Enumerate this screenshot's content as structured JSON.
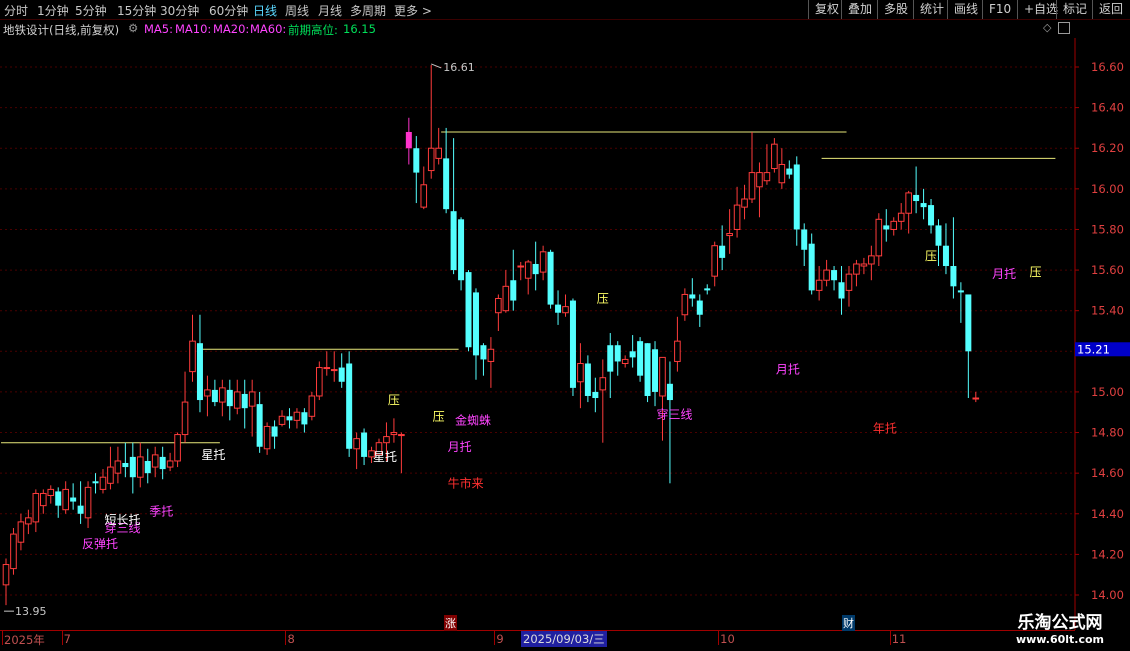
{
  "toolbar": {
    "periods": [
      "分时",
      "1分钟",
      "5分钟",
      "15分钟",
      "30分钟",
      "60分钟",
      "日线",
      "周线",
      "月线",
      "多周期",
      "更多 >"
    ],
    "active": "日线",
    "right_buttons": [
      "复权",
      "叠加",
      "多股",
      "统计",
      "画线",
      "F10",
      "+自选",
      "标记",
      "返回"
    ]
  },
  "infobar": {
    "title": "地铁设计(日线,前复权)",
    "ma5": "MA5:",
    "ma10": "MA10:",
    "ma20": "MA20:",
    "ma60": "MA60:",
    "prev_high_label": "前期高位:",
    "prev_high_value": "16.15"
  },
  "colors": {
    "up": "#ff3c3c",
    "down": "#54ffff",
    "resist_line": "#e8e87a",
    "label_magenta": "#ff44ff",
    "label_red": "#ff3030",
    "label_white": "#ffffff",
    "label_yellow": "#ffff66",
    "axis": "#a00000"
  },
  "chart_data": {
    "type": "candlestick",
    "y_axis_ticks": [
      "16.60",
      "16.40",
      "16.20",
      "16.00",
      "15.80",
      "15.60",
      "15.40",
      "15.20",
      "15.00",
      "14.80",
      "14.60",
      "14.40",
      "14.20",
      "14.00"
    ],
    "ylim": [
      14.0,
      16.6
    ],
    "current_price": "15.21",
    "high_label": "16.61",
    "low_label": "13.95",
    "candles": [
      [
        14.05,
        14.15,
        13.95,
        14.18
      ],
      [
        14.13,
        14.3,
        14.1,
        14.33
      ],
      [
        14.26,
        14.36,
        14.22,
        14.4
      ],
      [
        14.35,
        14.38,
        14.3,
        14.42
      ],
      [
        14.36,
        14.5,
        14.31,
        14.52
      ],
      [
        14.44,
        14.5,
        14.4,
        14.52
      ],
      [
        14.49,
        14.52,
        14.45,
        14.54
      ],
      [
        14.51,
        14.44,
        14.38,
        14.53
      ],
      [
        14.42,
        14.52,
        14.4,
        14.56
      ],
      [
        14.48,
        14.46,
        14.42,
        14.55
      ],
      [
        14.44,
        14.4,
        14.35,
        14.56
      ],
      [
        14.38,
        14.53,
        14.33,
        14.56
      ],
      [
        14.56,
        14.55,
        14.5,
        14.6
      ],
      [
        14.52,
        14.58,
        14.5,
        14.62
      ],
      [
        14.55,
        14.63,
        14.52,
        14.73
      ],
      [
        14.6,
        14.66,
        14.55,
        14.73
      ],
      [
        14.65,
        14.63,
        14.58,
        14.75
      ],
      [
        14.68,
        14.58,
        14.5,
        14.75
      ],
      [
        14.58,
        14.68,
        14.53,
        14.75
      ],
      [
        14.66,
        14.6,
        14.55,
        14.72
      ],
      [
        14.63,
        14.69,
        14.58,
        14.73
      ],
      [
        14.68,
        14.62,
        14.57,
        14.73
      ],
      [
        14.63,
        14.66,
        14.61,
        14.7
      ],
      [
        14.66,
        14.79,
        14.63,
        14.8
      ],
      [
        14.79,
        14.95,
        14.75,
        15.1
      ],
      [
        15.1,
        15.25,
        15.05,
        15.38
      ],
      [
        15.24,
        14.96,
        14.9,
        15.38
      ],
      [
        14.98,
        15.01,
        14.88,
        15.08
      ],
      [
        15.01,
        14.95,
        14.93,
        15.06
      ],
      [
        14.95,
        15.02,
        14.88,
        15.06
      ],
      [
        15.01,
        14.93,
        14.86,
        15.06
      ],
      [
        14.92,
        15.0,
        14.89,
        15.06
      ],
      [
        14.99,
        14.92,
        14.82,
        15.06
      ],
      [
        14.93,
        15.0,
        14.78,
        15.06
      ],
      [
        14.94,
        14.73,
        14.7,
        15.0
      ],
      [
        14.72,
        14.83,
        14.69,
        14.85
      ],
      [
        14.83,
        14.78,
        14.72,
        14.86
      ],
      [
        14.84,
        14.88,
        14.83,
        14.91
      ],
      [
        14.88,
        14.86,
        14.82,
        14.92
      ],
      [
        14.86,
        14.9,
        14.82,
        14.92
      ],
      [
        14.9,
        14.84,
        14.8,
        14.92
      ],
      [
        14.88,
        14.98,
        14.86,
        15.0
      ],
      [
        14.98,
        15.12,
        14.96,
        15.15
      ],
      [
        15.12,
        15.12,
        15.08,
        15.2
      ],
      [
        15.11,
        15.11,
        15.05,
        15.2
      ],
      [
        15.12,
        15.05,
        15.02,
        15.19
      ],
      [
        15.14,
        14.72,
        14.68,
        15.2
      ],
      [
        14.72,
        14.77,
        14.62,
        14.8
      ],
      [
        14.8,
        14.68,
        14.64,
        14.82
      ],
      [
        14.68,
        14.71,
        14.65,
        14.73
      ],
      [
        14.69,
        14.75,
        14.67,
        14.77
      ],
      [
        14.75,
        14.78,
        14.66,
        14.85
      ],
      [
        14.79,
        14.8,
        14.75,
        14.87
      ],
      [
        14.79,
        14.79,
        14.6,
        14.8
      ],
      [
        16.28,
        16.2,
        16.12,
        16.35
      ],
      [
        16.2,
        16.08,
        15.93,
        16.26
      ],
      [
        15.91,
        16.02,
        15.9,
        16.11
      ],
      [
        16.09,
        16.2,
        16.05,
        16.61
      ],
      [
        16.15,
        16.2,
        16.12,
        16.3
      ],
      [
        16.15,
        15.9,
        15.88,
        16.3
      ],
      [
        15.89,
        15.6,
        15.58,
        16.25
      ],
      [
        15.85,
        15.55,
        15.5,
        15.86
      ],
      [
        15.59,
        15.22,
        15.2,
        15.6
      ],
      [
        15.49,
        15.18,
        15.06,
        15.51
      ],
      [
        15.23,
        15.16,
        15.08,
        15.24
      ],
      [
        15.15,
        15.21,
        15.02,
        15.27
      ],
      [
        15.39,
        15.46,
        15.3,
        15.48
      ],
      [
        15.4,
        15.52,
        15.39,
        15.6
      ],
      [
        15.55,
        15.45,
        15.4,
        15.7
      ],
      [
        15.62,
        15.62,
        15.55,
        15.64
      ],
      [
        15.56,
        15.64,
        15.48,
        15.65
      ],
      [
        15.63,
        15.58,
        15.5,
        15.74
      ],
      [
        15.59,
        15.69,
        15.55,
        15.72
      ],
      [
        15.69,
        15.43,
        15.41,
        15.7
      ],
      [
        15.43,
        15.39,
        15.33,
        15.5
      ],
      [
        15.39,
        15.42,
        15.37,
        15.48
      ],
      [
        15.45,
        15.02,
        14.98,
        15.46
      ],
      [
        15.05,
        15.14,
        14.92,
        15.24
      ],
      [
        15.14,
        14.98,
        14.95,
        15.18
      ],
      [
        15.0,
        14.97,
        14.9,
        15.07
      ],
      [
        15.01,
        15.07,
        14.75,
        15.16
      ],
      [
        15.23,
        15.1,
        14.97,
        15.29
      ],
      [
        15.23,
        15.15,
        15.08,
        15.25
      ],
      [
        15.14,
        15.16,
        15.12,
        15.18
      ],
      [
        15.2,
        15.17,
        15.12,
        15.28
      ],
      [
        15.25,
        15.08,
        15.05,
        15.27
      ],
      [
        15.24,
        14.98,
        14.95,
        15.24
      ],
      [
        15.21,
        15.0,
        14.93,
        15.25
      ],
      [
        14.98,
        15.17,
        14.76,
        15.17
      ],
      [
        15.04,
        14.96,
        14.55,
        15.15
      ],
      [
        15.15,
        15.25,
        15.1,
        15.37
      ],
      [
        15.38,
        15.48,
        15.35,
        15.51
      ],
      [
        15.48,
        15.46,
        15.42,
        15.56
      ],
      [
        15.45,
        15.38,
        15.32,
        15.48
      ],
      [
        15.51,
        15.5,
        15.48,
        15.53
      ],
      [
        15.57,
        15.72,
        15.52,
        15.74
      ],
      [
        15.72,
        15.66,
        15.6,
        15.82
      ],
      [
        15.77,
        15.78,
        15.68,
        15.9
      ],
      [
        15.8,
        15.92,
        15.76,
        16.01
      ],
      [
        15.91,
        15.95,
        15.85,
        16.02
      ],
      [
        15.95,
        16.08,
        15.93,
        16.28
      ],
      [
        16.01,
        16.08,
        15.86,
        16.13
      ],
      [
        16.04,
        16.08,
        16.02,
        16.22
      ],
      [
        16.1,
        16.22,
        16.08,
        16.25
      ],
      [
        16.03,
        16.12,
        16.0,
        16.2
      ],
      [
        16.1,
        16.07,
        16.05,
        16.14
      ],
      [
        16.12,
        15.8,
        15.72,
        16.16
      ],
      [
        15.8,
        15.7,
        15.62,
        15.83
      ],
      [
        15.73,
        15.5,
        15.48,
        15.78
      ],
      [
        15.5,
        15.55,
        15.45,
        15.62
      ],
      [
        15.55,
        15.6,
        15.52,
        15.65
      ],
      [
        15.6,
        15.55,
        15.5,
        15.62
      ],
      [
        15.54,
        15.46,
        15.38,
        15.62
      ],
      [
        15.5,
        15.58,
        15.42,
        15.62
      ],
      [
        15.58,
        15.63,
        15.52,
        15.65
      ],
      [
        15.62,
        15.63,
        15.58,
        15.66
      ],
      [
        15.63,
        15.67,
        15.55,
        15.72
      ],
      [
        15.67,
        15.85,
        15.62,
        15.88
      ],
      [
        15.82,
        15.8,
        15.74,
        15.9
      ],
      [
        15.8,
        15.84,
        15.77,
        15.86
      ],
      [
        15.84,
        15.88,
        15.8,
        15.93
      ],
      [
        15.88,
        15.98,
        15.78,
        15.99
      ],
      [
        15.97,
        15.94,
        15.88,
        16.11
      ],
      [
        15.93,
        15.91,
        15.85,
        16.0
      ],
      [
        15.92,
        15.82,
        15.78,
        15.95
      ],
      [
        15.82,
        15.72,
        15.62,
        15.85
      ],
      [
        15.72,
        15.62,
        15.58,
        15.83
      ],
      [
        15.62,
        15.52,
        15.46,
        15.86
      ],
      [
        15.5,
        15.49,
        15.34,
        15.54
      ],
      [
        15.48,
        15.2,
        14.97,
        15.33
      ],
      [
        14.97,
        14.97,
        14.95,
        15.0
      ]
    ],
    "signal_labels": [
      {
        "text": "反弹托",
        "x_index": 11,
        "price": 14.25,
        "color": "magenta"
      },
      {
        "text": "穿三线",
        "x_index": 14,
        "price": 14.33,
        "color": "magenta"
      },
      {
        "text": "短长托",
        "x_index": 14,
        "price": 14.37,
        "color": "white"
      },
      {
        "text": "季托",
        "x_index": 20,
        "price": 14.41,
        "color": "magenta"
      },
      {
        "text": "星托",
        "x_index": 27,
        "price": 14.69,
        "color": "white"
      },
      {
        "text": "星托",
        "x_index": 50,
        "price": 14.68,
        "color": "white"
      },
      {
        "text": "压",
        "x_index": 52,
        "price": 14.96,
        "color": "yellow"
      },
      {
        "text": "压",
        "x_index": 58,
        "price": 14.88,
        "color": "yellow"
      },
      {
        "text": "金蜘蛛",
        "x_index": 61,
        "price": 14.86,
        "color": "magenta"
      },
      {
        "text": "月托",
        "x_index": 60,
        "price": 14.73,
        "color": "magenta"
      },
      {
        "text": "牛市来",
        "x_index": 60,
        "price": 14.55,
        "color": "red"
      },
      {
        "text": "压",
        "x_index": 80,
        "price": 15.46,
        "color": "yellow"
      },
      {
        "text": "穿三线",
        "x_index": 88,
        "price": 14.89,
        "color": "magenta"
      },
      {
        "text": "月托",
        "x_index": 104,
        "price": 15.11,
        "color": "magenta"
      },
      {
        "text": "年托",
        "x_index": 117,
        "price": 14.82,
        "color": "red"
      },
      {
        "text": "压",
        "x_index": 124,
        "price": 15.67,
        "color": "yellow"
      },
      {
        "text": "月托",
        "x_index": 133,
        "price": 15.58,
        "color": "magenta"
      },
      {
        "text": "压",
        "x_index": 138,
        "price": 15.59,
        "color": "yellow"
      }
    ],
    "resistance_lines": [
      {
        "price": 14.75,
        "from_index": 0,
        "to_index": 28
      },
      {
        "price": 15.21,
        "from_index": 27,
        "to_index": 60
      },
      {
        "price": 16.28,
        "from_index": 59,
        "to_index": 112
      },
      {
        "price": 16.15,
        "from_index": 110,
        "to_index": 140
      }
    ]
  },
  "datebar": {
    "labels": [
      {
        "text": "2025年",
        "x_index": 0
      },
      {
        "text": "7",
        "x_index": 8
      },
      {
        "text": "8",
        "x_index": 38
      },
      {
        "text": "9",
        "x_index": 66
      },
      {
        "text": "10",
        "x_index": 96
      },
      {
        "text": "11",
        "x_index": 119
      }
    ],
    "cursor_date": "2025/09/03/三",
    "marker_zhang": "涨",
    "marker_cai": "财"
  },
  "watermark": {
    "title": "乐淘公式网",
    "url": "www.60lt.com"
  }
}
